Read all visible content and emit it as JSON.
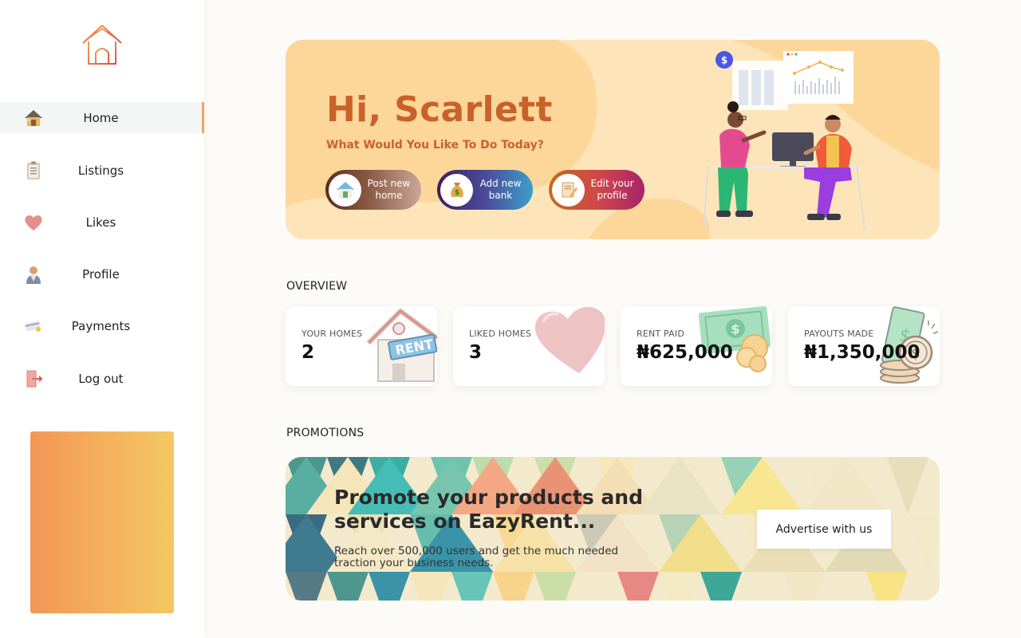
{
  "sidebar": {
    "logo_icon": "house-outline-icon",
    "items": [
      {
        "label": "Home",
        "icon": "house-icon",
        "active": true
      },
      {
        "label": "Listings",
        "icon": "clipboard-icon",
        "active": false
      },
      {
        "label": "Likes",
        "icon": "heart-icon",
        "active": false
      },
      {
        "label": "Profile",
        "icon": "person-icon",
        "active": false
      },
      {
        "label": "Payments",
        "icon": "card-icon",
        "active": false
      },
      {
        "label": "Log out",
        "icon": "door-exit-icon",
        "active": false
      }
    ]
  },
  "hero": {
    "greeting": "Hi, Scarlett",
    "subtitle": "What Would You Like To Do Today?",
    "actions": [
      {
        "label_line1": "Post new",
        "label_line2": "home",
        "icon": "house-icon"
      },
      {
        "label_line1": "Add new",
        "label_line2": "bank",
        "icon": "money-bag-icon"
      },
      {
        "label_line1": "Edit your",
        "label_line2": "profile",
        "icon": "edit-document-icon"
      }
    ],
    "illustration_badge": "$"
  },
  "overview": {
    "title": "OVERVIEW",
    "cards": [
      {
        "label": "YOUR HOMES",
        "value": "2",
        "icon": "rent-house-icon"
      },
      {
        "label": "LIKED HOMES",
        "value": "3",
        "icon": "heart-icon"
      },
      {
        "label": "RENT PAID",
        "value": "₦625,000",
        "icon": "cash-coins-icon"
      },
      {
        "label": "PAYOUTS MADE",
        "value": "₦1,350,000",
        "icon": "cash-coin-stack-icon"
      }
    ]
  },
  "promotions": {
    "title": "PROMOTIONS",
    "banner_title": "Promote your products and services on EazyRent...",
    "banner_text": "Reach over 500,000 users and get the much needed traction your business needs.",
    "button_label": "Advertise with us"
  },
  "colors": {
    "accent": "#f4a261",
    "hero_bg": "#fde5b9",
    "hero_text": "#c9622a"
  }
}
